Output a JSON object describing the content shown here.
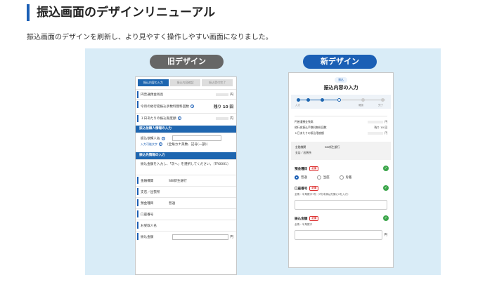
{
  "heading": "振込画面のデザインリニューアル",
  "description": "振込画面のデザインを刷新し、より見やすく操作しやすい画面になりました。",
  "old_label": "旧デザイン",
  "new_label": "新デザイン",
  "old": {
    "steps": [
      "振込内容の入力",
      "振込内容確認",
      "振込受付完了"
    ],
    "rows": {
      "fee": "円普通預金残高",
      "fee_unit": "円",
      "count_label": "今月の他行宛振込手数料無料回数",
      "count_value": "残り 10 回",
      "limit": "１日あたりの振込限度額",
      "limit_unit": "円"
    },
    "section1": "振込依頼人情報の入力",
    "requester_label": "振込依頼人名",
    "requester_sub": "入力可能文字",
    "requester_note": "（全角カナ英数、記号(一部)）",
    "section2": "振込先情報の入力",
    "info_text": "振込金額を入力し、「次へ」を選択してください。（TR0001）",
    "fields": {
      "bank_label": "金融機関",
      "bank_value": "SBI新生銀行",
      "branch": "支店／出張所",
      "type_label": "預金種目",
      "type_value": "普通",
      "account": "口座番号",
      "recipient": "お受取人名",
      "amount": "振込金額",
      "amount_unit": "円"
    }
  },
  "new": {
    "pill": "振込",
    "title": "振込内容の入力",
    "step_labels": [
      "入力",
      "確認",
      "完了"
    ],
    "list": [
      {
        "label": "円普通預金残高",
        "value": "円"
      },
      {
        "label": "他行宛振込手数料無料回数",
        "value": "残り 10 回"
      },
      {
        "label": "１日あたりの振込限度額",
        "value": "円"
      }
    ],
    "bank_label": "金融機関",
    "bank_value": "SBI新生銀行",
    "branch": "支店／出張所",
    "type_label": "預金種目",
    "required": "必須",
    "radios": [
      "普通",
      "当座",
      "貯蓄"
    ],
    "account_label": "口座番号",
    "account_sub": "全角・半角数字7桁（7桁未満は先頭に0を入力）",
    "amount_label": "振込金額",
    "amount_sub": "全角・半角数字",
    "amount_unit": "円"
  },
  "colors": {
    "accent": "#1b5fb5",
    "panel": "#d9ecf7",
    "check": "#3ca64b"
  }
}
